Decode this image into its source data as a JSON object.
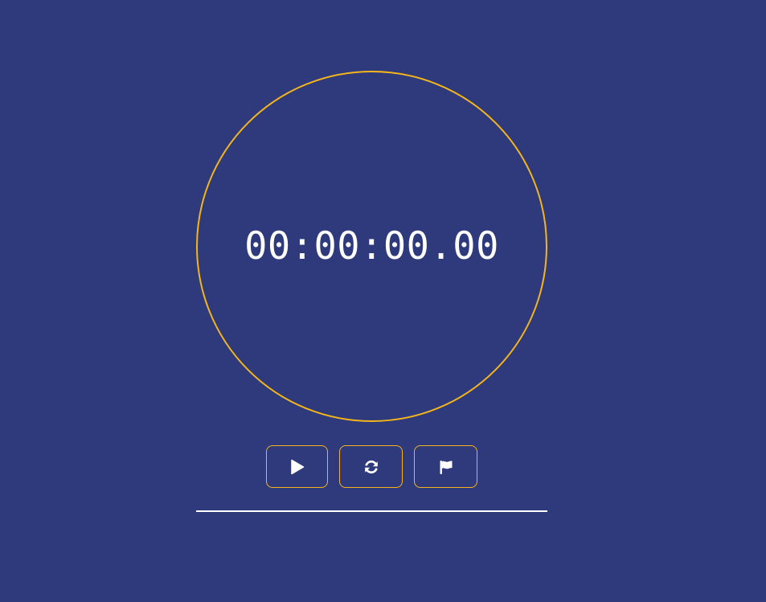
{
  "stopwatch": {
    "time": "00:00:00.00"
  },
  "controls": {
    "start_icon": "play-icon",
    "reset_icon": "refresh-icon",
    "lap_icon": "flag-icon"
  },
  "colors": {
    "background": "#2e3a7b",
    "accent": "#f4b51c",
    "text": "#ffffff"
  }
}
